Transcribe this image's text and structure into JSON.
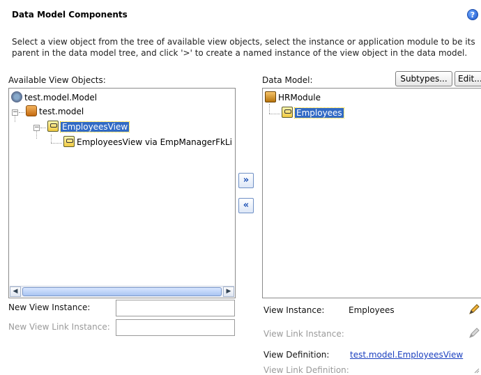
{
  "header": {
    "title": "Data Model Components",
    "help_icon": "?",
    "description": "Select a view object from the tree of available view objects, select the instance or application module to be its parent in the data model tree, and click '>' to create a named instance of the view object in the data model."
  },
  "available": {
    "label": "Available View Objects:",
    "tree": [
      {
        "label": "test.model.Model",
        "icon": "app-package-icon"
      },
      {
        "label": "test.model",
        "icon": "package-icon",
        "toggle": "−"
      },
      {
        "label": "EmployeesView",
        "icon": "view-object-icon",
        "toggle": "−",
        "selected": true
      },
      {
        "label": "EmployeesView via EmpManagerFkLi",
        "icon": "view-object-icon"
      }
    ]
  },
  "transfer": {
    "add_glyph": "»",
    "remove_glyph": "«"
  },
  "data_model": {
    "label": "Data Model:",
    "subtypes_button": "Subtypes...",
    "edit_button": "Edit...",
    "tree": [
      {
        "label": "HRModule",
        "icon": "application-module-icon"
      },
      {
        "label": "Employees",
        "icon": "view-object-icon",
        "selected": true
      }
    ]
  },
  "new_instance": {
    "view_instance_label": "New View Instance:",
    "view_instance_value": "",
    "view_link_instance_label": "New View Link Instance:",
    "view_link_instance_value": ""
  },
  "details": {
    "view_instance_label": "View Instance:",
    "view_instance_value": "Employees",
    "view_link_instance_label": "View Link Instance:",
    "view_definition_label": "View Definition:",
    "view_definition_value": "test.model.EmployeesView",
    "view_link_definition_label": "View Link Definition:"
  },
  "colors": {
    "selection": "#316ac5",
    "link": "#1a3fbf",
    "disabled_text": "#9a9a9a"
  }
}
